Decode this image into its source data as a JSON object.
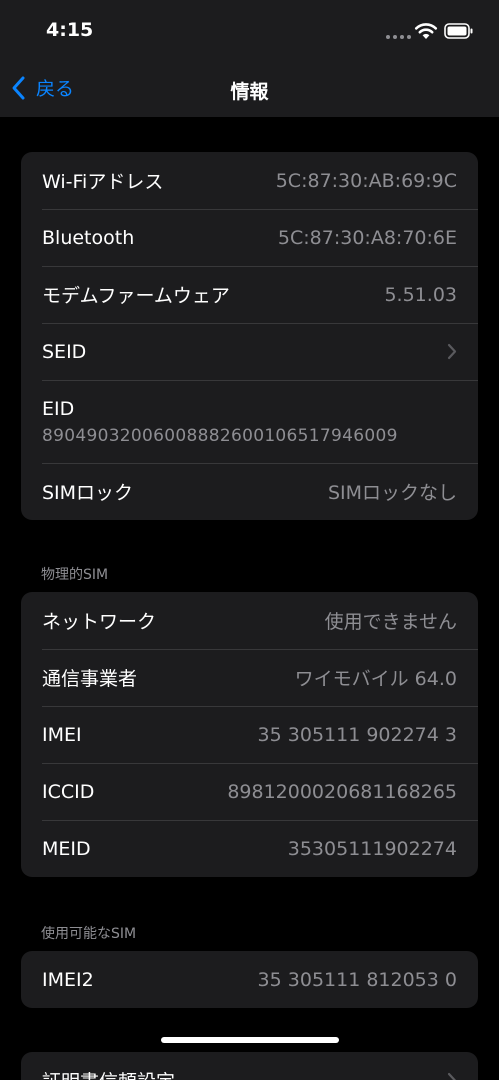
{
  "status": {
    "time": "4:15"
  },
  "nav": {
    "back_label": "戻る",
    "title": "情報"
  },
  "group1": [
    {
      "label": "Wi-Fiアドレス",
      "value": "5C:87:30:AB:69:9C"
    },
    {
      "label": "Bluetooth",
      "value": "5C:87:30:A8:70:6E"
    },
    {
      "label": "モデムファームウェア",
      "value": "5.51.03"
    },
    {
      "label": "SEID"
    },
    {
      "label": "EID",
      "value": "89049032006008882600106517946009"
    },
    {
      "label": "SIMロック",
      "value": "SIMロックなし"
    }
  ],
  "section2": {
    "header": "物理的SIM"
  },
  "group2": [
    {
      "label": "ネットワーク",
      "value": "使用できません"
    },
    {
      "label": "通信事業者",
      "value": "ワイモバイル 64.0"
    },
    {
      "label": "IMEI",
      "value": "35 305111 902274 3"
    },
    {
      "label": "ICCID",
      "value": "8981200020681168265"
    },
    {
      "label": "MEID",
      "value": "35305111902274"
    }
  ],
  "section3": {
    "header": "使用可能なSIM"
  },
  "group3": [
    {
      "label": "IMEI2",
      "value": "35 305111 812053 0"
    }
  ],
  "group4": [
    {
      "label": "証明書信頼設定"
    }
  ]
}
